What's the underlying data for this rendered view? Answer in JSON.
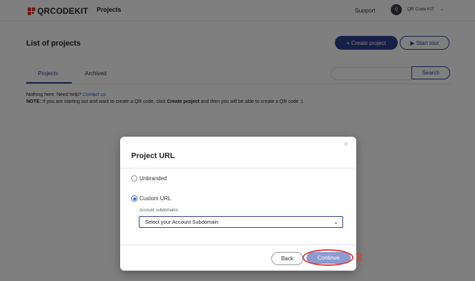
{
  "header": {
    "logo_text": "QRCODEKIT",
    "nav_projects": "Projects",
    "support": "Support",
    "avatar_initial": "Q",
    "account_name": "QR Code KIT",
    "brand_color": "#d9302f"
  },
  "page": {
    "title": "List of projects",
    "create_button": "+ Create project",
    "tour_button": "▶ Start tour",
    "tabs": [
      {
        "label": "Projects",
        "active": true
      },
      {
        "label": "Archived",
        "active": false
      }
    ],
    "search_placeholder": "",
    "search_button": "Search",
    "empty_text": "Nothing here. Need help?",
    "contact_link": "Contact us",
    "note_label": "NOTE:",
    "note_text_1": " If you are starting out and want to create a QR code, click ",
    "note_bold": "Create project",
    "note_text_2": " and then you will be able to create a QR code :)",
    "accent_color": "#2c3e8f"
  },
  "modal": {
    "title": "Project URL",
    "close": "×",
    "options": [
      {
        "label": "Unbranded",
        "selected": false
      },
      {
        "label": "Custom URL",
        "selected": true
      }
    ],
    "subdomain_label": "Account subdomains",
    "subdomain_select": "Select your Account Subdomain",
    "back_button": "Back",
    "continue_button": "Continue"
  },
  "annotation": {
    "step_number": "8",
    "color": "#e03b3b"
  }
}
